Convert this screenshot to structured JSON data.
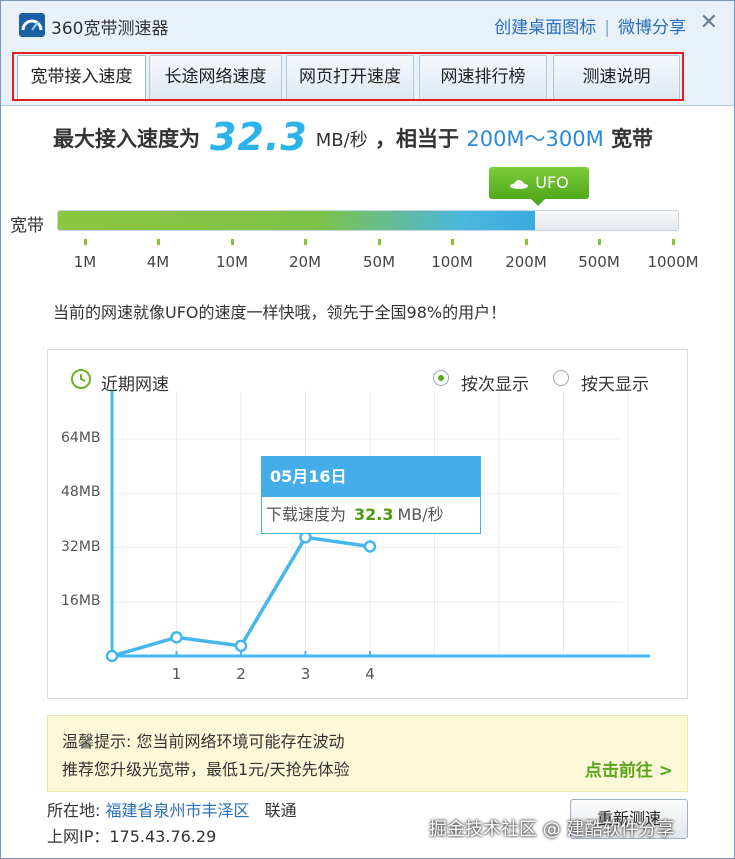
{
  "window": {
    "title": "360宽带测速器",
    "links": [
      "创建桌面图标",
      "微博分享"
    ],
    "close": "✕"
  },
  "tabs": [
    {
      "label": "宽带接入速度",
      "active": true
    },
    {
      "label": "长途网络速度",
      "active": false
    },
    {
      "label": "网页打开速度",
      "active": false
    },
    {
      "label": "网速排行榜",
      "active": false
    },
    {
      "label": "测速说明",
      "active": false
    }
  ],
  "headline": {
    "prefix": "最大接入速度为",
    "speed": "32.3",
    "unit": "MB/秒",
    "mid": "，相当于",
    "range": "200M～300M",
    "suffix": "宽带"
  },
  "speed_bar": {
    "label": "宽带",
    "badge": "UFO",
    "fill_fraction": 0.77,
    "ticks": [
      "1M",
      "4M",
      "10M",
      "20M",
      "50M",
      "100M",
      "200M",
      "500M",
      "1000M"
    ]
  },
  "comparison_text": "当前的网速就像UFO的速度一样快哦，领先于全国98%的用户！",
  "chart": {
    "title": "近期网速",
    "options": [
      {
        "label": "按次显示",
        "checked": true
      },
      {
        "label": "按天显示",
        "checked": false
      }
    ],
    "tooltip": {
      "date": "05月16日",
      "label": "下载速度为",
      "value": "32.3",
      "unit": "MB/秒"
    }
  },
  "chart_data": {
    "type": "line",
    "x": [
      0,
      1,
      2,
      3,
      4
    ],
    "values": [
      0,
      5.5,
      3,
      35,
      32.3
    ],
    "categories": [
      "1",
      "2",
      "3",
      "4"
    ],
    "y_ticks": [
      "64MB",
      "48MB",
      "32MB",
      "16MB"
    ],
    "ylim": [
      0,
      80
    ],
    "grid": true,
    "color": "#45b6ee"
  },
  "notice": {
    "line1": "温馨提示: 您当前网络环境可能存在波动",
    "line2": "推荐您升级光宽带，最低1元/天抢先体验",
    "link": "点击前往 >"
  },
  "footer": {
    "location_label": "所在地:",
    "location": "福建省泉州市丰泽区",
    "isp": "联通",
    "ip_label": "上网IP：",
    "ip": "175.43.76.29",
    "retest": "重新测速",
    "watermark": "掘金技术社区 @ 建酷软件分享"
  }
}
